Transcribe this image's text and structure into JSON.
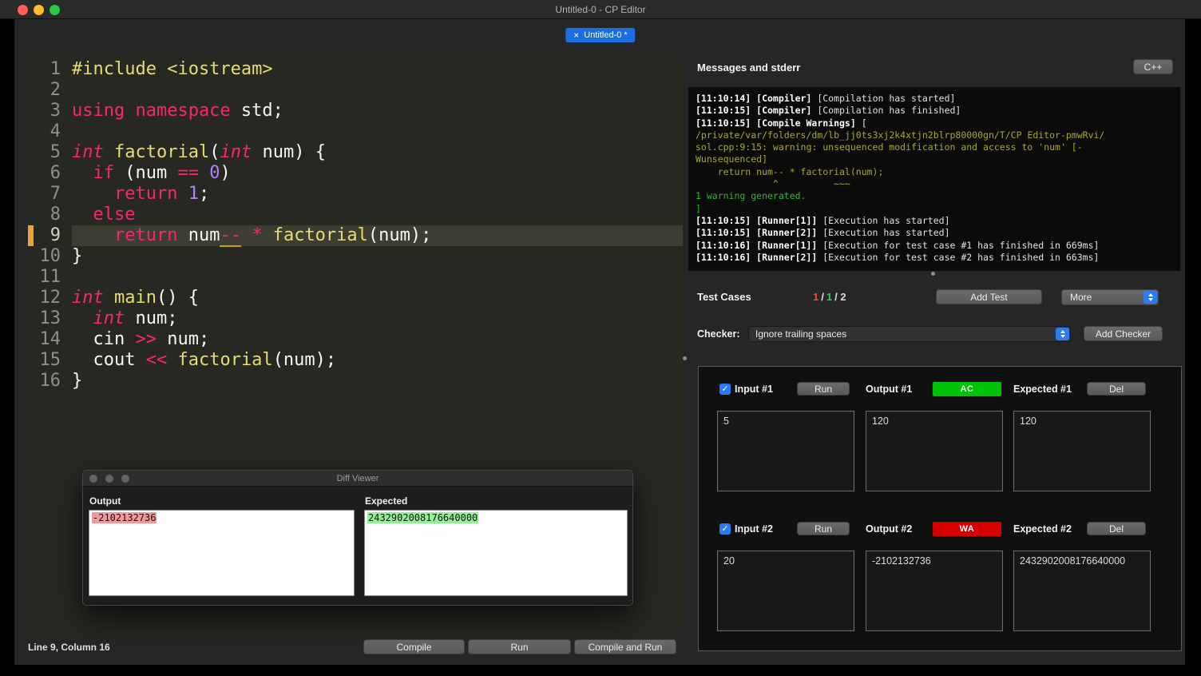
{
  "colors": {
    "accent_blue": "#2b7af7",
    "tab_blue": "#1c6ce2",
    "ac_green": "#00c30a",
    "wa_red": "#d60000",
    "keyword_pink": "#f92672",
    "function_yellow": "#e6db74",
    "number_purple": "#ae81ff",
    "warning_olive": "#a8a829",
    "success_green": "#2db82d",
    "current_line_bg": "#3e3d32",
    "line_marker_orange": "#e8a33d"
  },
  "titlebar": {
    "title": "Untitled-0 - CP Editor"
  },
  "tab": {
    "close_icon": "×",
    "label": "Untitled-0 *"
  },
  "editor": {
    "status": "Line 9, Column 16",
    "current_line": 9,
    "lines": [
      {
        "n": "1",
        "seg": [
          [
            "pp",
            "#include <iostream>"
          ]
        ]
      },
      {
        "n": "2",
        "seg": []
      },
      {
        "n": "3",
        "seg": [
          [
            "kw",
            "using namespace"
          ],
          [
            "pl",
            " std;"
          ]
        ]
      },
      {
        "n": "4",
        "seg": []
      },
      {
        "n": "5",
        "seg": [
          [
            "ty",
            "int"
          ],
          [
            "pl",
            " "
          ],
          [
            "fn",
            "factorial"
          ],
          [
            "pl",
            "("
          ],
          [
            "ty",
            "int"
          ],
          [
            "pl",
            " num) {"
          ]
        ]
      },
      {
        "n": "6",
        "seg": [
          [
            "pl",
            "  "
          ],
          [
            "kw",
            "if"
          ],
          [
            "pl",
            " (num "
          ],
          [
            "kw",
            "=="
          ],
          [
            "pl",
            " "
          ],
          [
            "nu",
            "0"
          ],
          [
            "pl",
            ")"
          ]
        ]
      },
      {
        "n": "7",
        "seg": [
          [
            "pl",
            "    "
          ],
          [
            "kw",
            "return"
          ],
          [
            "pl",
            " "
          ],
          [
            "nu",
            "1"
          ],
          [
            "pl",
            ";"
          ]
        ]
      },
      {
        "n": "8",
        "seg": [
          [
            "pl",
            "  "
          ],
          [
            "kw",
            "else"
          ]
        ]
      },
      {
        "n": "9",
        "seg": [
          [
            "pl",
            "    "
          ],
          [
            "kw",
            "return"
          ],
          [
            "pl",
            " num"
          ],
          [
            "uw",
            "--"
          ],
          [
            "pl",
            " "
          ],
          [
            "kw",
            "*"
          ],
          [
            "pl",
            " "
          ],
          [
            "fn",
            "factorial"
          ],
          [
            "pl",
            "(num);"
          ]
        ]
      },
      {
        "n": "10",
        "seg": [
          [
            "pl",
            "}"
          ]
        ]
      },
      {
        "n": "11",
        "seg": []
      },
      {
        "n": "12",
        "seg": [
          [
            "ty",
            "int"
          ],
          [
            "pl",
            " "
          ],
          [
            "fn",
            "main"
          ],
          [
            "pl",
            "() {"
          ]
        ]
      },
      {
        "n": "13",
        "seg": [
          [
            "pl",
            "  "
          ],
          [
            "ty",
            "int"
          ],
          [
            "pl",
            " num;"
          ]
        ]
      },
      {
        "n": "14",
        "seg": [
          [
            "pl",
            "  cin "
          ],
          [
            "kw",
            ">>"
          ],
          [
            "pl",
            " num;"
          ]
        ]
      },
      {
        "n": "15",
        "seg": [
          [
            "pl",
            "  cout "
          ],
          [
            "kw",
            "<<"
          ],
          [
            "pl",
            " "
          ],
          [
            "fn",
            "factorial"
          ],
          [
            "pl",
            "(num);"
          ]
        ]
      },
      {
        "n": "16",
        "seg": [
          [
            "pl",
            "}"
          ]
        ]
      }
    ]
  },
  "actions": {
    "compile": "Compile",
    "run": "Run",
    "compile_and_run": "Compile and Run"
  },
  "messages": {
    "title": "Messages and stderr",
    "lang_button": "C++",
    "lines": [
      {
        "time": "[11:10:14]",
        "tag": "[Compiler]",
        "msg": "[Compilation has started]"
      },
      {
        "time": "[11:10:15]",
        "tag": "[Compiler]",
        "msg": "[Compilation has finished]"
      },
      {
        "time": "[11:10:15]",
        "tag": "[Compile Warnings]",
        "msg": "["
      },
      {
        "warn": "/private/var/folders/dm/lb_jj0ts3xj2k4xtjn2blrp80000gn/T/CP Editor-pmwRvi/"
      },
      {
        "warn": "sol.cpp:9:15: warning: unsequenced modification and access to 'num' [-"
      },
      {
        "warn": "Wunsequenced]"
      },
      {
        "warn": "    return num-- * factorial(num);"
      },
      {
        "warn": "              ^          ~~~"
      },
      {
        "ok": "1 warning generated."
      },
      {
        "ok": "]"
      },
      {
        "time": "[11:10:15]",
        "tag": "[Runner[1]]",
        "msg": "[Execution has started]"
      },
      {
        "time": "[11:10:15]",
        "tag": "[Runner[2]]",
        "msg": "[Execution has started]"
      },
      {
        "time": "[11:10:16]",
        "tag": "[Runner[1]]",
        "msg": "[Execution for test case #1 has finished in 669ms]"
      },
      {
        "time": "[11:10:16]",
        "tag": "[Runner[2]]",
        "msg": "[Execution for test case #2 has finished in 663ms]"
      }
    ]
  },
  "testcases": {
    "title": "Test Cases",
    "summary": [
      [
        "red",
        "1"
      ],
      [
        "sep",
        "/"
      ],
      [
        "green",
        "1"
      ],
      [
        "sep",
        "/ 2"
      ]
    ],
    "add_test": "Add Test",
    "more": "More",
    "checker_label": "Checker:",
    "checker_value": "Ignore trailing spaces",
    "add_checker": "Add Checker",
    "run": "Run",
    "del": "Del",
    "check_icon": "✓",
    "cases": [
      {
        "input_label": "Input #1",
        "output_label": "Output #1",
        "expected_label": "Expected #1",
        "verdict": "AC",
        "checked": true,
        "input": "5",
        "output": "120",
        "expected": "120"
      },
      {
        "input_label": "Input #2",
        "output_label": "Output #2",
        "expected_label": "Expected #2",
        "verdict": "WA",
        "checked": true,
        "input": "20",
        "output": "-2102132736",
        "expected": "2432902008176640000"
      }
    ]
  },
  "diff": {
    "title": "Diff Viewer",
    "output_label": "Output",
    "expected_label": "Expected",
    "output_value": "-2102132736",
    "expected_value": "2432902008176640000"
  }
}
